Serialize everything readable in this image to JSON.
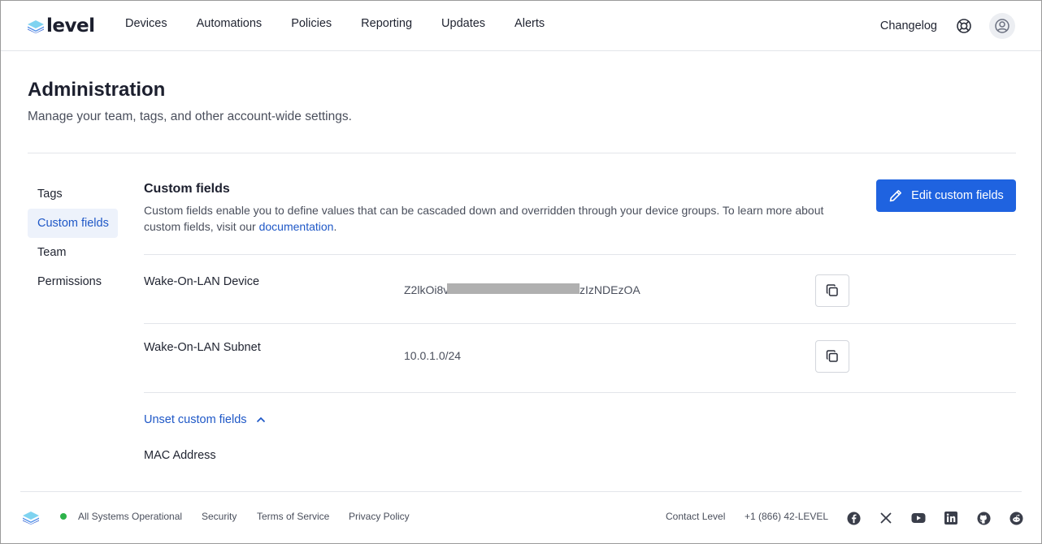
{
  "brand": {
    "name": "level"
  },
  "nav": {
    "items": [
      {
        "label": "Devices"
      },
      {
        "label": "Automations"
      },
      {
        "label": "Policies"
      },
      {
        "label": "Reporting"
      },
      {
        "label": "Updates"
      },
      {
        "label": "Alerts"
      }
    ],
    "changelog": "Changelog"
  },
  "page": {
    "title": "Administration",
    "subtitle": "Manage your team, tags, and other account-wide settings."
  },
  "side_menu": {
    "items": [
      {
        "label": "Tags",
        "active": false
      },
      {
        "label": "Custom fields",
        "active": true
      },
      {
        "label": "Team",
        "active": false
      },
      {
        "label": "Permissions",
        "active": false
      }
    ]
  },
  "custom_fields": {
    "title": "Custom fields",
    "description_before": "Custom fields enable you to define values that can be cascaded down and overridden through your device groups. To learn more about custom fields, visit our ",
    "description_link": "documentation",
    "description_after": ".",
    "edit_button": "Edit custom fields",
    "rows": [
      {
        "name": "Wake-On-LAN Device",
        "value_prefix": "Z2lkOi8v",
        "value_suffix": "zIzNDEzOA"
      },
      {
        "name": "Wake-On-LAN Subnet",
        "value": "10.0.1.0/24"
      }
    ],
    "unset_toggle": "Unset custom fields",
    "unset_fields": [
      {
        "name": "MAC Address"
      }
    ]
  },
  "footer": {
    "status": "All Systems Operational",
    "links": [
      "Security",
      "Terms of Service",
      "Privacy Policy"
    ],
    "contact": "Contact Level",
    "phone": "+1 (866) 42-LEVEL",
    "social_icons": [
      "facebook-icon",
      "x-icon",
      "youtube-icon",
      "linkedin-icon",
      "github-icon",
      "reddit-icon"
    ]
  },
  "colors": {
    "accent": "#1f63e0",
    "link": "#1f58c7",
    "status_ok": "#2db24a",
    "active_menu_bg": "#edf2fb"
  }
}
